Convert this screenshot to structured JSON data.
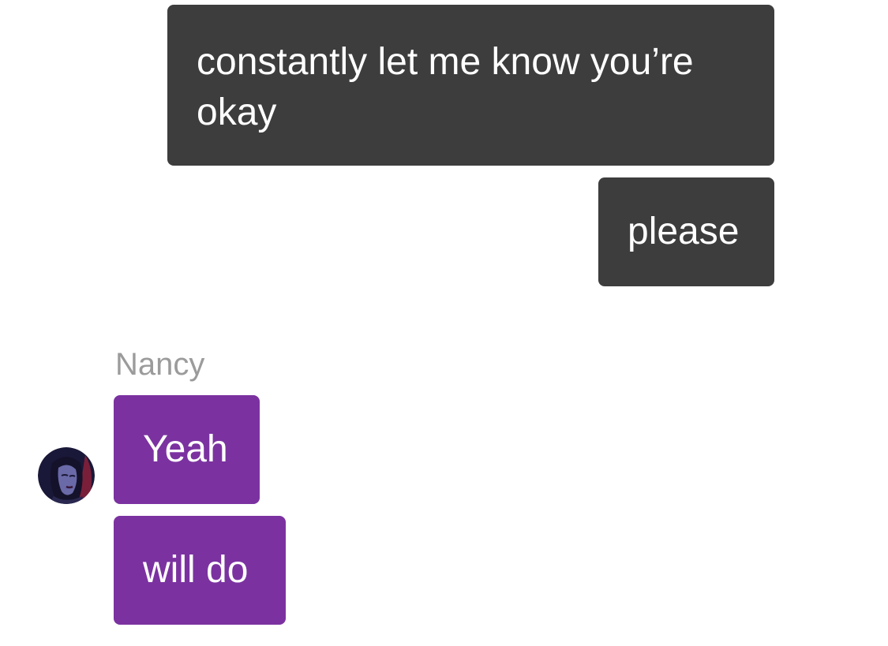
{
  "conversation": {
    "outgoing": [
      {
        "text": "constantly let me know you’re okay"
      },
      {
        "text": "please"
      }
    ],
    "incoming_group": {
      "sender": "Nancy",
      "avatar_icon": "user-avatar-illustration",
      "messages": [
        {
          "text": "Yeah"
        },
        {
          "text": "will do"
        }
      ]
    }
  },
  "colors": {
    "outgoing_bubble": "#3d3d3d",
    "incoming_bubble": "#7b32a0",
    "sender_name": "#9b9b9b",
    "bubble_text": "#ffffff",
    "background": "#ffffff"
  }
}
